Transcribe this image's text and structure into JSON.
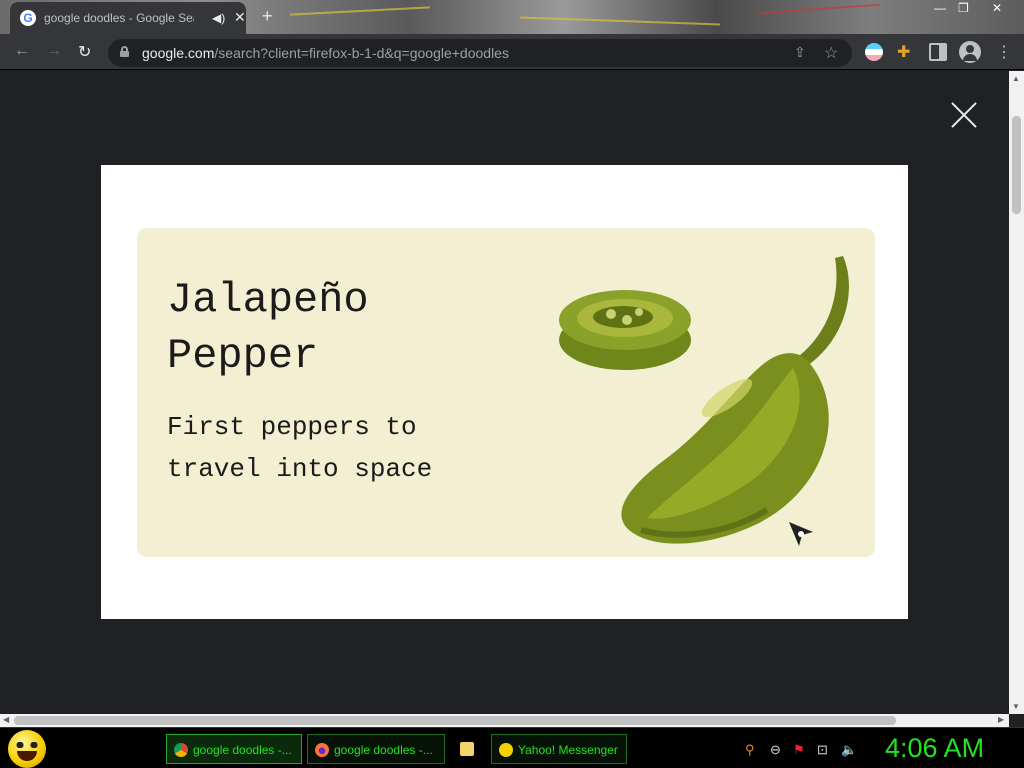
{
  "browser": {
    "tab": {
      "title": "google doodles - Google Search"
    },
    "new_tab_symbol": "+",
    "url": {
      "host": "google.com",
      "path": "/search?client=firefox-b-1-d&q=google+doodles"
    }
  },
  "doodle": {
    "title": "Jalapeño Pepper",
    "subtitle": "First peppers to travel into space"
  },
  "taskbar": {
    "buttons": [
      {
        "label": "google doodles -...",
        "icon": "chrome-icon"
      },
      {
        "label": "google doodles -...",
        "icon": "firefox-icon"
      },
      {
        "label": "",
        "icon": "folder-icon"
      },
      {
        "label": "Yahoo! Messenger",
        "icon": "yahoo-messenger-icon"
      }
    ],
    "clock": "4:06 AM"
  },
  "colors": {
    "page_background": "#202124",
    "doodle_card": "#f2efd2",
    "pepper": "#7b8f1e",
    "clock": "#22e222"
  }
}
